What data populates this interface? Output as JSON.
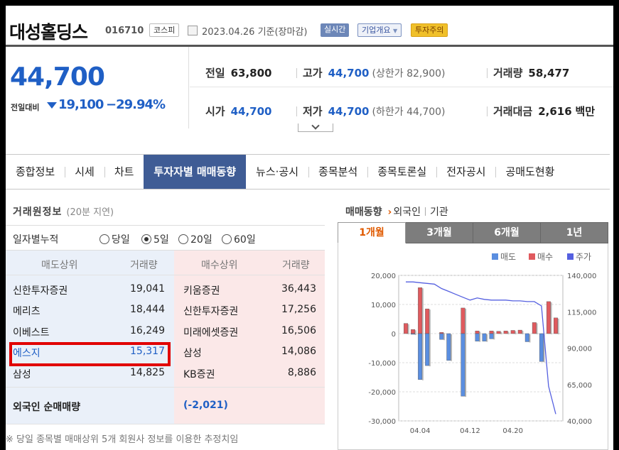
{
  "header": {
    "name": "대성홀딩스",
    "code": "016710",
    "market": "코스피",
    "date": "2023.04.26 기준(장마감)",
    "realtime": "실시간",
    "company_info": "기업개요",
    "warning": "투자주의"
  },
  "price": {
    "current": "44,700",
    "change_label": "전일대비",
    "change": "19,100",
    "change_pct": "−29.94%"
  },
  "stats": {
    "prev_label": "전일",
    "prev": "63,800",
    "high_label": "고가",
    "high": "44,700",
    "upper_label": "(상한가",
    "upper": "82,900)",
    "volume_label": "거래량",
    "volume": "58,477",
    "open_label": "시가",
    "open": "44,700",
    "low_label": "저가",
    "low": "44,700",
    "lower_label": "(하한가",
    "lower": "44,700)",
    "amount_label": "거래대금",
    "amount": "2,616",
    "amount_unit": "백만"
  },
  "tabs": [
    "종합정보",
    "시세",
    "차트",
    "투자자별 매매동향",
    "뉴스·공시",
    "종목분석",
    "종목토론실",
    "전자공시",
    "공매도현황"
  ],
  "trade": {
    "title": "거래원정보",
    "delay": "(20분 지연)",
    "accum_label": "일자별누적",
    "radios": [
      "당일",
      "5일",
      "20일",
      "60일"
    ],
    "head_sell": "매도상위",
    "head_vol1": "거래량",
    "head_buy": "매수상위",
    "head_vol2": "거래량",
    "rows": [
      {
        "sell": "신한투자증권",
        "sell_vol": "19,041",
        "buy": "키움증권",
        "buy_vol": "36,443"
      },
      {
        "sell": "메리츠",
        "sell_vol": "18,444",
        "buy": "신한투자증권",
        "buy_vol": "17,256"
      },
      {
        "sell": "이베스트",
        "sell_vol": "16,249",
        "buy": "미래에셋증권",
        "buy_vol": "16,506"
      },
      {
        "sell": "에스지",
        "sell_vol": "15,317",
        "buy": "삼성",
        "buy_vol": "14,086"
      },
      {
        "sell": "삼성",
        "sell_vol": "14,825",
        "buy": "KB증권",
        "buy_vol": "8,886"
      }
    ],
    "foreign_label": "외국인 순매매량",
    "foreign_value": "(-2,021)",
    "note": "※ 당일 종목별 매매상위 5개 회원사 정보를 이용한 추정치임"
  },
  "trend": {
    "title": "매매동향",
    "opt_foreign": "외국인",
    "opt_inst": "기관",
    "periods": [
      "1개월",
      "3개월",
      "6개월",
      "1년"
    ]
  },
  "chart_data": {
    "type": "bar",
    "legend": [
      "매도",
      "매수",
      "주가"
    ],
    "legend_position": "top-right",
    "x_tick_labels": [
      "04.04",
      "04.12",
      "04.20"
    ],
    "y_left_ticks": [
      "20,000",
      "10,000",
      "0",
      "-10,000",
      "-20,000",
      "-30,000"
    ],
    "y_right_ticks": [
      "140,000",
      "115,000",
      "90,000",
      "65,000",
      "40,000"
    ],
    "ylim_left": [
      -30000,
      20000
    ],
    "ylim_right": [
      40000,
      140000
    ],
    "grid": true,
    "sell": [
      0,
      -200,
      -15800,
      -11000,
      0,
      -2000,
      -9200,
      0,
      -21500,
      0,
      -2600,
      -2600,
      -1800,
      0,
      0,
      0,
      0,
      -2800,
      0,
      -9600,
      0
    ],
    "buy": [
      3500,
      1400,
      15800,
      8500,
      0,
      400,
      0,
      0,
      8800,
      0,
      900,
      0,
      900,
      800,
      900,
      1100,
      1200,
      0,
      3800,
      0,
      11000,
      5400
    ],
    "price": [
      135500,
      135500,
      135000,
      134500,
      134000,
      131000,
      129000,
      127000,
      125000,
      123000,
      124500,
      123500,
      123000,
      123000,
      123000,
      122500,
      122500,
      122000,
      122000,
      119000,
      63800,
      44700
    ]
  },
  "colors": {
    "accent_blue": "#1f5fc5",
    "tab_active": "#3f5c95",
    "sell_bar": "#5a8ee0",
    "buy_bar": "#e05a5e",
    "price_line": "#5560e0",
    "highlight_box": "#e10000",
    "period_active": "#e05a00"
  }
}
